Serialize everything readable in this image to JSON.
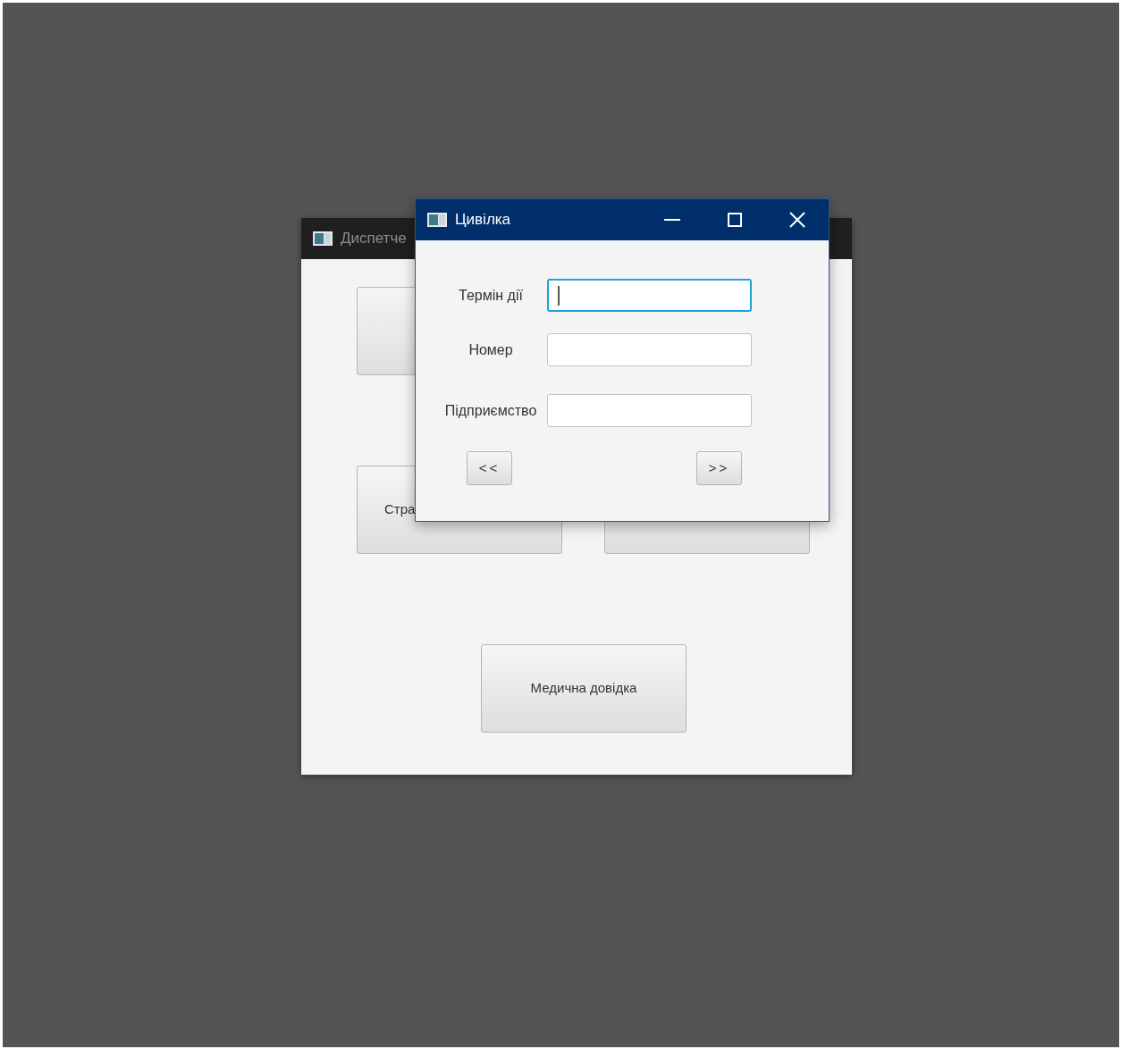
{
  "back_window": {
    "title": "Диспетче",
    "buttons": [
      {
        "label": "Стра"
      },
      {
        "label": "Медична довідка"
      }
    ]
  },
  "dialog": {
    "title": "Цивілка",
    "fields": [
      {
        "label": "Термін дії",
        "focused": true
      },
      {
        "label": "Номер",
        "focused": false
      },
      {
        "label": "Підприємство",
        "focused": false
      }
    ],
    "buttons": [
      "<<",
      ">>"
    ]
  }
}
